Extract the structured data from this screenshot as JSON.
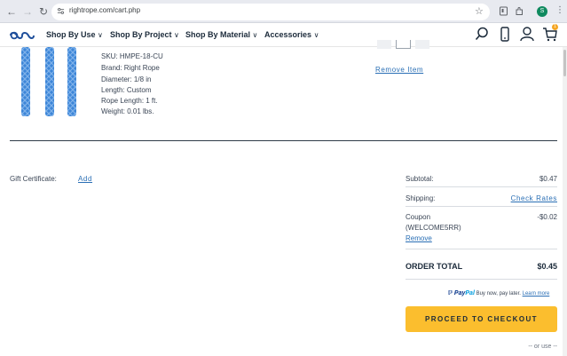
{
  "browser": {
    "url": "rightrope.com/cart.php",
    "avatar_letter": "S",
    "accent": "#0f8a5f"
  },
  "site": {
    "nav": [
      {
        "label": "Shop By Use"
      },
      {
        "label": "Shop By Project"
      },
      {
        "label": "Shop By Material"
      },
      {
        "label": "Accessories"
      }
    ],
    "cart_count": "1",
    "badge_color": "#f5a623"
  },
  "product": {
    "details": [
      "SKU: HMPE-18-CU",
      "Brand: Right Rope",
      "Diameter: 1/8 in",
      "Length: Custom",
      "Rope Length: 1 ft.",
      "Weight: 0.01 lbs."
    ],
    "remove_label": "Remove Item"
  },
  "gift": {
    "label": "Gift Certificate:",
    "add_label": "Add"
  },
  "summary": {
    "subtotal_label": "Subtotal:",
    "subtotal_value": "$0.47",
    "shipping_label": "Shipping:",
    "shipping_value": "Check Rates",
    "coupon_label": "Coupon",
    "coupon_code": "(WELCOME5RR)",
    "coupon_value": "-$0.02",
    "coupon_remove": "Remove",
    "total_label": "ORDER TOTAL",
    "total_value": "$0.45"
  },
  "paypal": {
    "brand_a": "Pay",
    "brand_b": "Pal",
    "tagline": "Buy now, pay later.",
    "learn_more": "Learn more"
  },
  "checkout": {
    "label": "PROCEED TO CHECKOUT",
    "color": "#fbbe2e",
    "or_use": "-- or use --"
  }
}
